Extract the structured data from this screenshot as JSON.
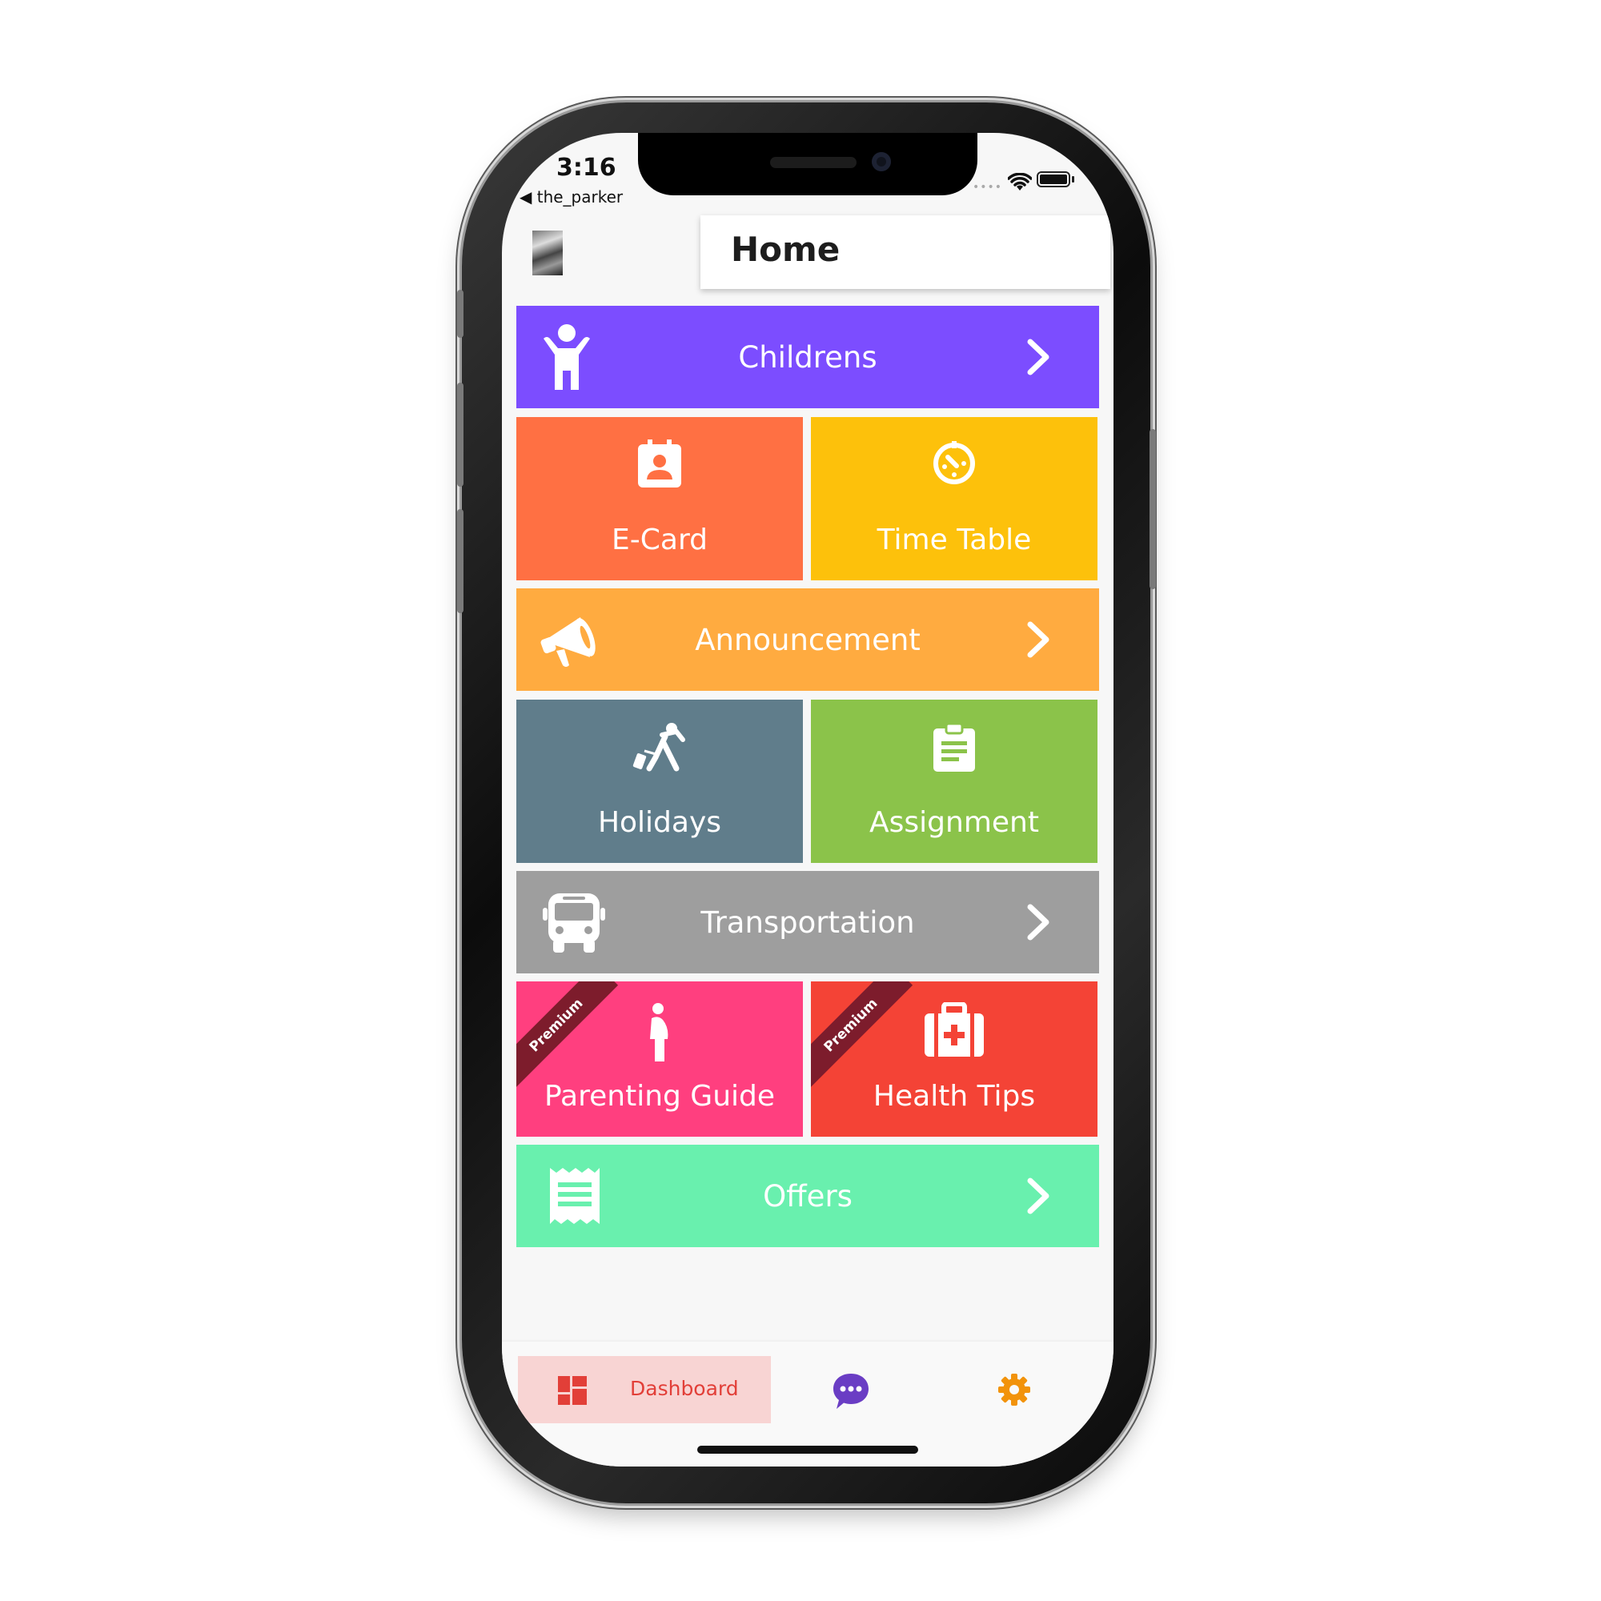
{
  "status_bar": {
    "time": "3:16",
    "back_label": "◀ the_parker",
    "signal_dots": "••••"
  },
  "header": {
    "title": "Home"
  },
  "tiles": {
    "childrens": {
      "label": "Childrens",
      "color": "#7c4dff",
      "icon": "child-icon"
    },
    "ecard": {
      "label": "E-Card",
      "color": "#ff7043",
      "icon": "contact-card-icon"
    },
    "timetable": {
      "label": "Time Table",
      "color": "#fdc10b",
      "icon": "timer-icon"
    },
    "announcement": {
      "label": "Announcement",
      "color": "#ffab40",
      "icon": "megaphone-icon"
    },
    "holidays": {
      "label": "Holidays",
      "color": "#607d8b",
      "icon": "traveler-icon"
    },
    "assignment": {
      "label": "Assignment",
      "color": "#8bc34a",
      "icon": "clipboard-icon"
    },
    "transportation": {
      "label": "Transportation",
      "color": "#9e9e9e",
      "icon": "bus-icon"
    },
    "parenting": {
      "label": "Parenting Guide",
      "color": "#ff3f7f",
      "icon": "pregnant-woman-icon",
      "badge": "Premium"
    },
    "health": {
      "label": "Health Tips",
      "color": "#f44336",
      "icon": "medical-bag-icon",
      "badge": "Premium"
    },
    "offers": {
      "label": "Offers",
      "color": "#69f0ae",
      "icon": "receipt-icon"
    }
  },
  "bottom_nav": {
    "dashboard": {
      "label": "Dashboard",
      "color": "#e23f38",
      "icon": "dashboard-icon"
    },
    "chat": {
      "icon": "chat-icon",
      "color": "#6a3dc4"
    },
    "settings": {
      "icon": "gear-icon",
      "color": "#f2930b"
    }
  }
}
